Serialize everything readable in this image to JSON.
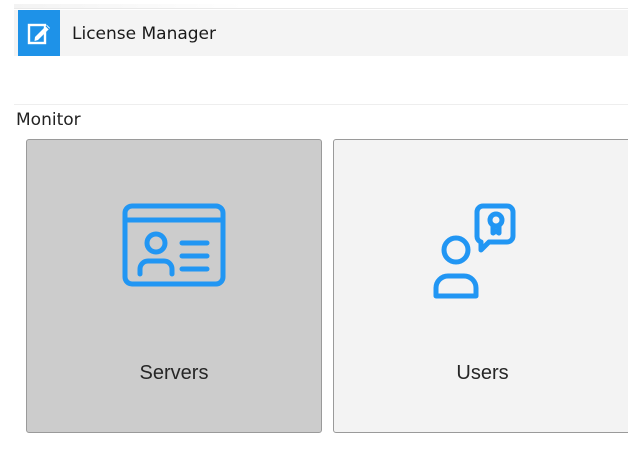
{
  "app": {
    "title": "License Manager",
    "logo_icon": "edit-document-icon",
    "accent_color": "#1e92e8"
  },
  "section": {
    "heading": "Monitor"
  },
  "tiles": [
    {
      "label": "Servers",
      "icon": "id-card-icon",
      "selected": true,
      "background": "#cccccc"
    },
    {
      "label": "Users",
      "icon": "user-license-icon",
      "selected": false,
      "background": "#f3f3f3"
    }
  ],
  "icon_color": "#2196f3"
}
